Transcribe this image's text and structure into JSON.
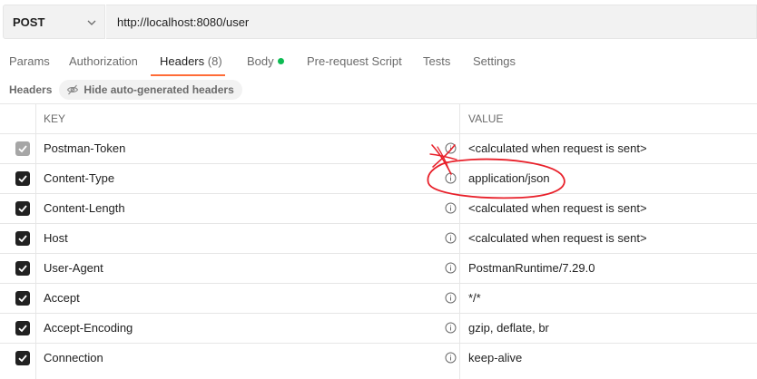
{
  "request": {
    "method": "POST",
    "url": "http://localhost:8080/user"
  },
  "tabs": [
    {
      "label": "Params"
    },
    {
      "label": "Authorization"
    },
    {
      "label": "Headers",
      "count": "(8)",
      "active": true
    },
    {
      "label": "Body",
      "indicator": "green-dot"
    },
    {
      "label": "Pre-request Script"
    },
    {
      "label": "Tests"
    },
    {
      "label": "Settings"
    }
  ],
  "headers_section": {
    "title": "Headers",
    "hide_button": "Hide auto-generated headers"
  },
  "table": {
    "columns": [
      "KEY",
      "VALUE"
    ],
    "rows": [
      {
        "key": "Postman-Token",
        "value": "<calculated when request is sent>",
        "checked": true,
        "disabled": true
      },
      {
        "key": "Content-Type",
        "value": "application/json",
        "checked": true
      },
      {
        "key": "Content-Length",
        "value": "<calculated when request is sent>",
        "checked": true
      },
      {
        "key": "Host",
        "value": "<calculated when request is sent>",
        "checked": true
      },
      {
        "key": "User-Agent",
        "value": "PostmanRuntime/7.29.0",
        "checked": true
      },
      {
        "key": "Accept",
        "value": "*/*",
        "checked": true
      },
      {
        "key": "Accept-Encoding",
        "value": "gzip, deflate, br",
        "checked": true
      },
      {
        "key": "Connection",
        "value": "keep-alive",
        "checked": true
      }
    ]
  },
  "colors": {
    "accent": "#ff6c37",
    "body_dot": "#0cbb52",
    "annotation": "#e8202a"
  }
}
